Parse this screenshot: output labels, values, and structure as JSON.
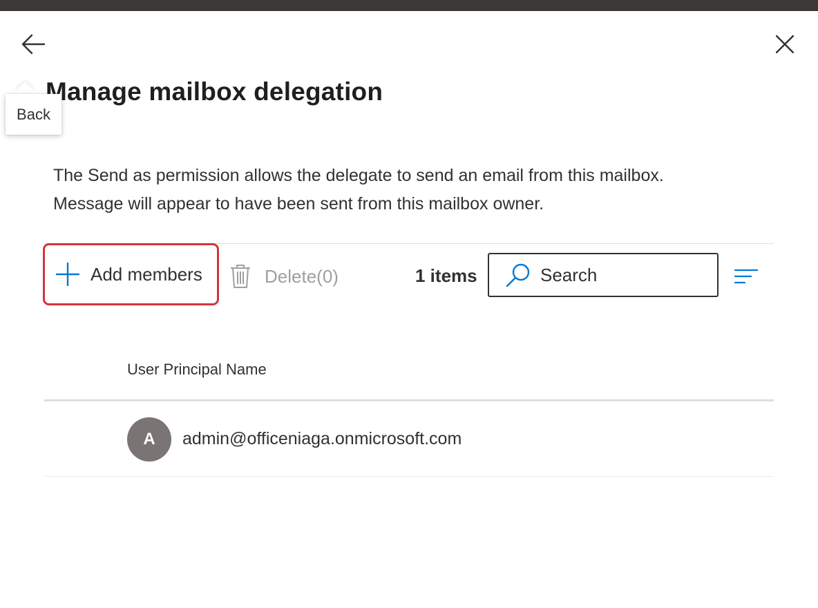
{
  "panel": {
    "title": "Manage mailbox delegation",
    "back_tooltip": "Back",
    "description_line1": "The Send as permission allows the delegate to send an email from this mailbox.",
    "description_line2": "Message will appear to have been sent from this mailbox owner."
  },
  "toolbar": {
    "add_label": "Add members",
    "delete_label": "Delete(0)",
    "items_count": "1 items",
    "search_placeholder": "Search"
  },
  "table": {
    "column_header": "User Principal Name",
    "rows": [
      {
        "avatar_initial": "A",
        "upn": "admin@officeniaga.onmicrosoft.com"
      }
    ]
  },
  "icons": {
    "back": "arrow-left-icon",
    "close": "close-icon",
    "add": "plus-icon",
    "delete": "trash-icon",
    "search": "search-icon",
    "filter": "filter-lines-icon"
  },
  "colors": {
    "accent": "#0078d4",
    "highlight": "#d13438",
    "disabled": "#a19f9d",
    "avatar": "#7a7574"
  }
}
